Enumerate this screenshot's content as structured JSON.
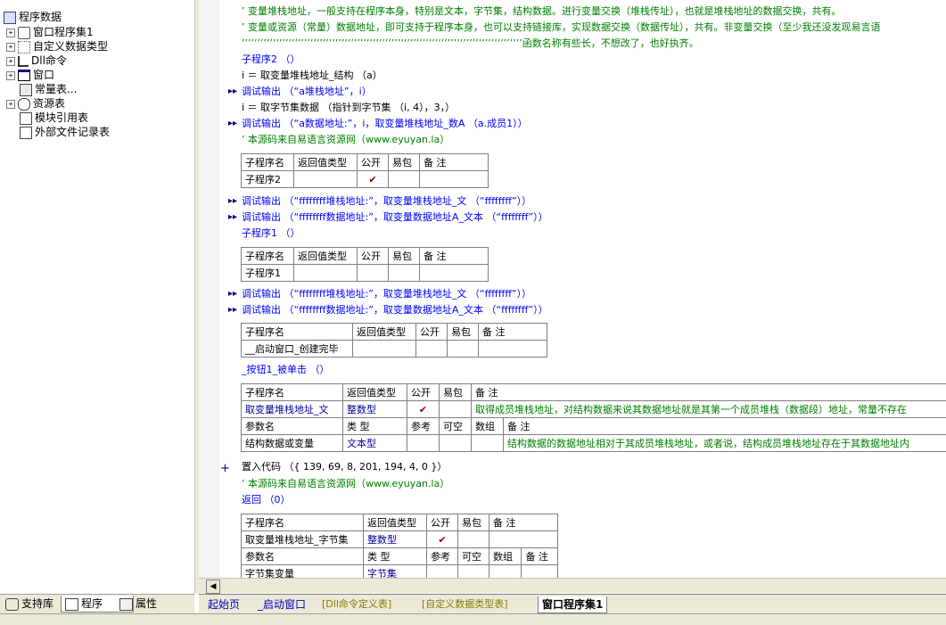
{
  "tree": {
    "root_label": "程序数据",
    "items": [
      {
        "label": "窗口程序集1",
        "expander": "+"
      },
      {
        "label": "自定义数据类型",
        "expander": "+"
      },
      {
        "label": "Dll命令",
        "expander": "+"
      },
      {
        "label": "窗口",
        "expander": "+"
      },
      {
        "label": "常量表...",
        "expander": ""
      },
      {
        "label": "资源表",
        "expander": "+"
      },
      {
        "label": "模块引用表",
        "expander": ""
      },
      {
        "label": "外部文件记录表",
        "expander": ""
      }
    ]
  },
  "panel_tabs": [
    "支持库",
    "程序",
    "属性"
  ],
  "code": {
    "comment1": "’ 变量堆栈地址，一般支持在程序本身，特别是文本，字节集，结构数据。进行变量交换（堆栈传址），也就是堆栈地址的数据交换，共有。",
    "comment2": "’ 变量或资源（常量）数据地址，即可支持于程序本身，也可以支持链接库，实现数据交换（数据传址），共有。非变量交换（至少我还没发现易言语",
    "comment3": "’’’’’’’’’’’’’’’’’’’’’’’’’’’’’’’’’’’’’’’’’’’’’’’’’’’’’’’’’’’’’’’’’’’’’’’’’’’’’’’’’’’’’’’’’’函数名称有些长，不想改了，也好执齐。",
    "sub2_call": "子程序2 （）",
    "line_i1": "i ＝ 取变量堆栈地址_结构 （a）",
    "debug1": "调试输出 （“a堆栈地址”，i）",
    "line_i2": "i ＝ 取字节集数据 （指针到字节集 （i, 4），3，）",
    "debug2": "调试输出 （“a数据地址:”，i，取变量堆栈地址_数A （a.成员1））",
    "source1": "’ 本源码来自易语言资源网（www.eyuyan.la）",
    "table_sub2": {
      "headers": [
        "子程序名",
        "返回值类型",
        "公开",
        "易包",
        "备 注"
      ],
      "name": "子程序2"
    },
    "debug3": "调试输出 （“ffffffff堆栈地址:”，取变量堆栈地址_文 （“ffffffff”））",
    "debug4": "调试输出 （“ffffffff数据地址:”，取变量数据地址A_文本 （“ffffffff”））",
    "sub1_call": "子程序1 （）",
    "table_sub1": {
      "headers": [
        "子程序名",
        "返回值类型",
        "公开",
        "易包",
        "备 注"
      ],
      "name": "子程序1"
    },
    "debug5": "调试输出 （“ffffffff堆栈地址:”，取变量堆栈地址_文 （“ffffffff”））",
    "debug6": "调试输出 （“ffffffff数据地址:”，取变量数据地址A_文本 （“ffffffff”））",
    "table_startup": {
      "headers": [
        "子程序名",
        "返回值类型",
        "公开",
        "易包",
        "备 注"
      ],
      "name": "__启动窗口_创建完毕"
    },
    "button_event": "_按钮1_被单击 （）",
    "table_stack": {
      "headers": [
        "子程序名",
        "返回值类型",
        "公开",
        "易包",
        "备 注"
      ],
      "name": "取变量堆栈地址_文",
      "ret": "整数型",
      "note": "取得成员堆栈地址，对结构数据来说其数据地址就是其第一个成员堆栈（数据段）地址，常量不存在",
      "param_headers": [
        "参数名",
        "类 型",
        "参考",
        "可空",
        "数组",
        "备 注"
      ],
      "param_name": "结构数据或变量",
      "param_type": "文本型",
      "param_note": "结构数据的数据地址相对于其成员堆栈地址，或者说，结构成员堆栈地址存在于其数据地址内"
    },
    "insert_code": "置入代码 （{ 139, 69, 8, 201, 194, 4, 0 }）",
    "source2": "’ 本源码来自易语言资源网（www.eyuyan.la）",
    "ret_line": "返回 （0）",
    "table_bytes": {
      "headers": [
        "子程序名",
        "返回值类型",
        "公开",
        "易包",
        "备 注"
      ],
      "name": "取变量堆栈地址_字节集",
      "ret": "整数型",
      "param_headers": [
        "参数名",
        "类 型",
        "参考",
        "可空",
        "数组",
        "备 注"
      ],
      "param_name": "字节集变量",
      "param_type": "字节集"
    }
  },
  "doc_tabs": [
    "起始页",
    "_启动窗口",
    "[Dll命令定义表]",
    "[自定义数据类型表]",
    "窗口程序集1"
  ],
  "check_mark": "✔",
  "colors": {
    "comment": "#008000",
    "function": "#0000ff",
    "panel": "#ece9d8"
  }
}
